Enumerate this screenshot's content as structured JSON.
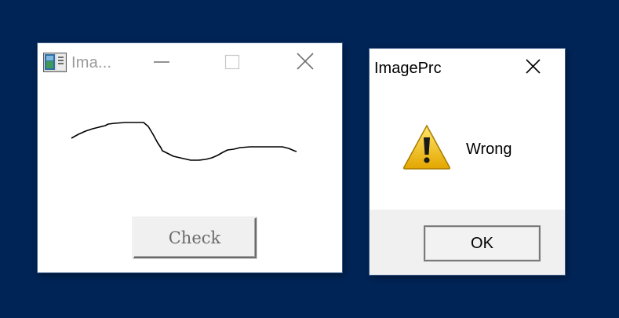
{
  "main_window": {
    "title": "Ima...",
    "icon": "app-image-icon",
    "caption_buttons": [
      "minimize-icon",
      "maximize-icon",
      "close-icon"
    ],
    "check_button_label": "Check"
  },
  "dialog": {
    "title": "ImagePrc",
    "icon": "warning-icon",
    "message": "Wrong",
    "ok_label": "OK"
  },
  "colors": {
    "desktop": "#012456",
    "warning_yellow": "#f2c200",
    "stroke": "#000000"
  }
}
